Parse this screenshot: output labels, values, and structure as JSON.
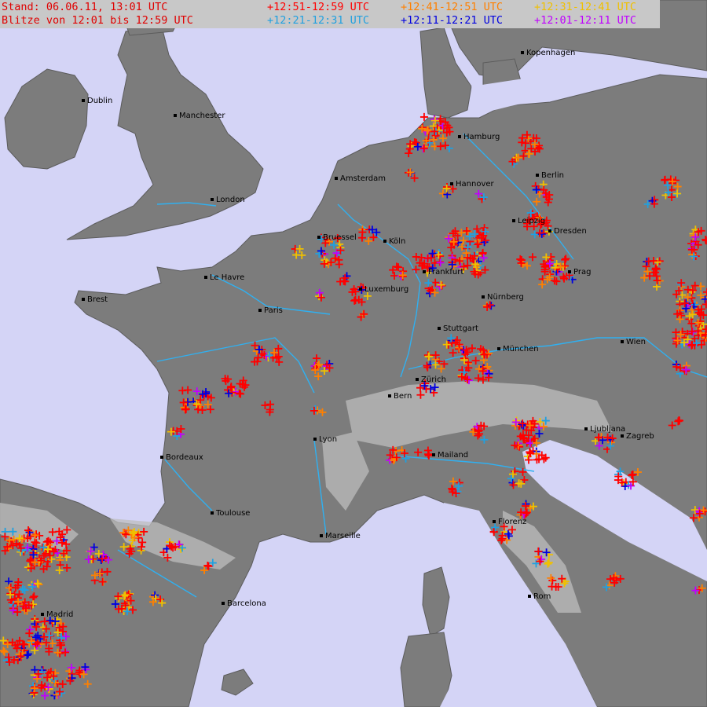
{
  "header": {
    "stand": "Stand: 06.06.11, 13:01 UTC",
    "blitze": "Blitze von 12:01 bis 12:59 UTC"
  },
  "legend": [
    {
      "label": "+12:51-12:59 UTC",
      "color": "#ff0000"
    },
    {
      "label": "+12:41-12:51 UTC",
      "color": "#ff8000"
    },
    {
      "label": "+12:31-12:41 UTC",
      "color": "#f0c000"
    },
    {
      "label": "+12:21-12:31 UTC",
      "color": "#20a0e0"
    },
    {
      "label": "+12:11-12:21 UTC",
      "color": "#0000e0"
    },
    {
      "label": "+12:01-12:11 UTC",
      "color": "#c000ff"
    }
  ],
  "colors": {
    "sea": "#d4d4f6",
    "land": "#7c7c7c",
    "rivers": "#30b0f0",
    "legend_bg": "#c8c8c8"
  },
  "cities": [
    {
      "name": "Kopenhagen"
    },
    {
      "name": "Dublin"
    },
    {
      "name": "Manchester"
    },
    {
      "name": "Hamburg"
    },
    {
      "name": "Amsterdam"
    },
    {
      "name": "Berlin"
    },
    {
      "name": "Hannover"
    },
    {
      "name": "London"
    },
    {
      "name": "Leipzig"
    },
    {
      "name": "Dresden"
    },
    {
      "name": "Bruessel"
    },
    {
      "name": "Köln"
    },
    {
      "name": "Prag"
    },
    {
      "name": "Le Havre"
    },
    {
      "name": "Frankfurt"
    },
    {
      "name": "Luxemburg"
    },
    {
      "name": "Brest"
    },
    {
      "name": "Nürnberg"
    },
    {
      "name": "Paris"
    },
    {
      "name": "Stuttgart"
    },
    {
      "name": "Wien"
    },
    {
      "name": "München"
    },
    {
      "name": "Zürich"
    },
    {
      "name": "Bern"
    },
    {
      "name": "Ljubljana"
    },
    {
      "name": "Zagreb"
    },
    {
      "name": "Lyon"
    },
    {
      "name": "Mailand"
    },
    {
      "name": "Bordeaux"
    },
    {
      "name": "Toulouse"
    },
    {
      "name": "Marseille"
    },
    {
      "name": "Florenz"
    },
    {
      "name": "Barcelona"
    },
    {
      "name": "Madrid"
    },
    {
      "name": "Rom"
    }
  ]
}
